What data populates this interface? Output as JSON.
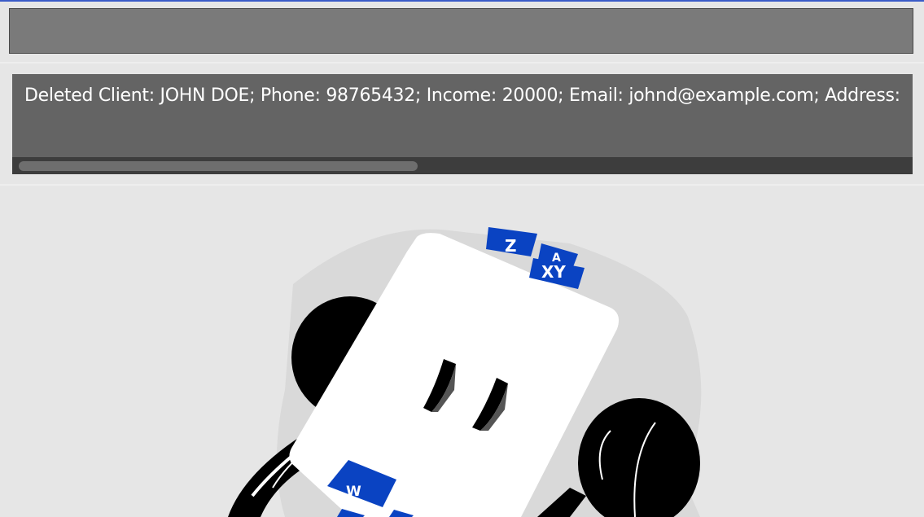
{
  "command_box": {
    "value": "",
    "placeholder": ""
  },
  "result_display": {
    "message": "Deleted Client: JOHN DOE; Phone: 98765432; Income: 20000; Email: johnd@example.com; Address:"
  },
  "placeholder_image": {
    "icon": "rolodex-icon",
    "tab_labels": [
      "Z",
      "A",
      "XY",
      "W"
    ]
  },
  "colors": {
    "background": "#e6e6e6",
    "command_box": "#7a7a7a",
    "result_pane": "#646464",
    "tab_blue": "#0a43c2",
    "accent_line": "#3a5bc7"
  }
}
